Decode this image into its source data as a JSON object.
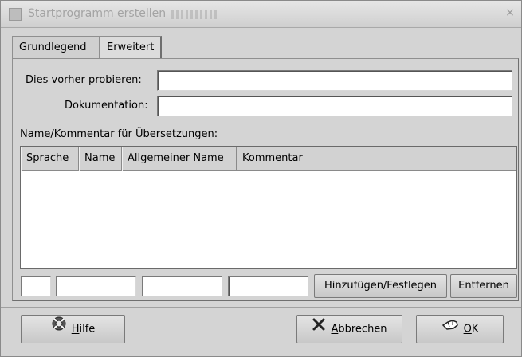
{
  "window": {
    "title": "Startprogramm erstellen",
    "close_symbol": "×"
  },
  "tabs": [
    {
      "label": "Grundlegend",
      "active": false
    },
    {
      "label": "Erweitert",
      "active": true
    }
  ],
  "form": {
    "try_label": "Dies vorher probieren:",
    "try_value": "",
    "doc_label": "Dokumentation:",
    "doc_value": ""
  },
  "translations": {
    "heading": "Name/Kommentar für Übersetzungen:",
    "columns": [
      "Sprache",
      "Name",
      "Allgemeiner Name",
      "Kommentar"
    ],
    "rows": [],
    "add_button": "Hinzufügen/Festlegen",
    "remove_button": "Entfernen"
  },
  "buttons": {
    "help_mnemonic": "H",
    "help_rest": "ilfe",
    "cancel_mnemonic": "A",
    "cancel_rest": "bbrechen",
    "ok_mnemonic": "O",
    "ok_rest": "K"
  },
  "icons": {
    "help": "lifebuoy-icon",
    "cancel": "x-icon",
    "ok": "ok-hand-icon"
  },
  "colors": {
    "window_bg": "#d4d4d4",
    "title_text": "#a3a3a3"
  }
}
